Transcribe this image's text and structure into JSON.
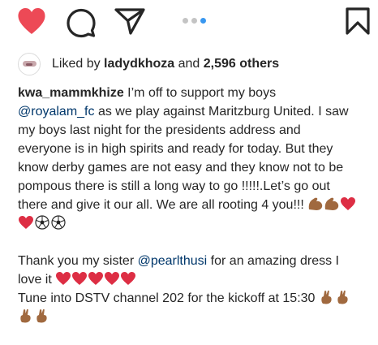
{
  "actions": {
    "like_icon": "heart-filled-icon",
    "comment_icon": "comment-icon",
    "share_icon": "paper-plane-icon",
    "save_icon": "bookmark-icon",
    "carousel_dots": 3,
    "carousel_active_index": 2
  },
  "likes": {
    "prefix": "Liked by ",
    "user": "ladydkhoza",
    "middle": " and ",
    "count": "2,596 others"
  },
  "caption": {
    "username": "kwa_mammkhize",
    "l1_text": " I’m off to support my boys",
    "l2_mention": "@royalam_fc",
    "l2_text": " as we play against Maritzburg United. I saw",
    "l3": "my boys last night for the presidents address and",
    "l4": "everyone is in high spirits and ready for today. But they",
    "l5": "know derby games are not easy and they know not to be",
    "l6": "pompous there is still a long way to go !!!!!.Let’s go out",
    "l7": "there and give it our all. We are all rooting 4 you!!! ",
    "l9_text": "Thank you my sister ",
    "l9_mention": "@pearlthusi",
    "l9_text2": " for an amazing dress I",
    "l10": "love it ",
    "l11": "Tune into DSTV channel 202 for the kickoff at 15:30"
  },
  "colors": {
    "heart": "#ed4956",
    "text": "#262626",
    "mention": "#00376b",
    "dot_active": "#3897f0",
    "dot_inactive": "#c4c4c4",
    "muscle": "#a0693f"
  }
}
